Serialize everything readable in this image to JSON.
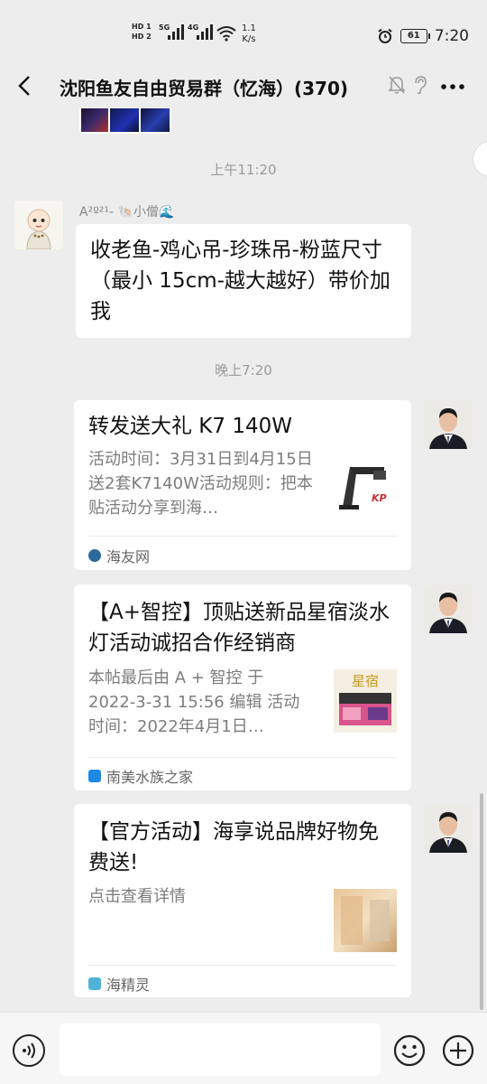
{
  "status_bar": {
    "sim1": "HD 1",
    "sim2": "HD 2",
    "net1": "5G",
    "net2": "4G",
    "speed_value": "1.1",
    "speed_unit": "K/s",
    "battery": "61",
    "time": "7:20"
  },
  "header": {
    "title": "沈阳鱼友自由贸易群（忆海）(370)"
  },
  "messages": {
    "time1": "上午11:20",
    "sender_name": "A²º²¹- 🐚小僧🌊",
    "text_message": "收老鱼-鸡心吊-珍珠吊-粉蓝尺寸（最小 15cm-越大越好）带价加我",
    "time2": "晚上7:20",
    "cards": [
      {
        "title": "转发送大礼 K7 140W",
        "desc": "活动时间：3月31日到4月15日送2套K7140W活动规则：把本贴活动分享到海…",
        "source": "海友网",
        "thumb_label": "KP"
      },
      {
        "title": "【A+智控】顶贴送新品星宿淡水灯活动诚招合作经销商",
        "desc": " 本帖最后由 A + 智控 于 2022-3-31 15:56 编辑 活动时间：2022年4月1日…",
        "source": "南美水族之家",
        "thumb_label": "星宿"
      },
      {
        "title": "【官方活动】海享说品牌好物免费送!",
        "desc": "点击查看详情",
        "source": "海精灵",
        "thumb_label": ""
      }
    ]
  },
  "colors": {
    "background": "#ededed",
    "bubble": "#ffffff",
    "secondary_text": "#7d7d7d",
    "source_icon_1": "#2a6a9a",
    "source_icon_2": "#1e88e5",
    "source_icon_3": "#4fb3d9"
  },
  "icons": {
    "back": "chevron-left-icon",
    "mute": "bell-off-icon",
    "ear": "ear-icon",
    "more": "more-dots-icon",
    "voice": "voice-icon",
    "emoji": "emoji-icon",
    "plus": "plus-circle-icon"
  }
}
